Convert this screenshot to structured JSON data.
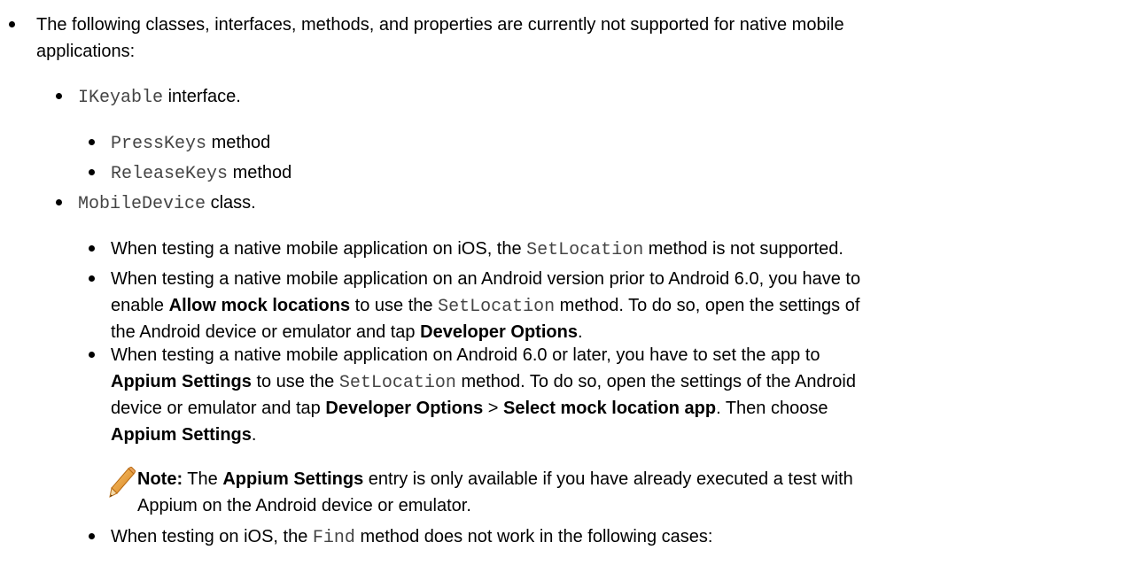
{
  "list": {
    "intro_line1": "The following classes, interfaces, methods, and properties are currently not supported for native mobile",
    "intro_line2": "applications:",
    "ikeyable": {
      "code": "IKeyable",
      "text": " interface."
    },
    "presskeys": {
      "code": "PressKeys",
      "text": " method"
    },
    "releasekeys": {
      "code": "ReleaseKeys",
      "text": " method"
    },
    "mobiledevice": {
      "code": "MobileDevice",
      "text": " class."
    },
    "item_ios": {
      "pre": "When testing a native mobile application on iOS, the ",
      "code": "SetLocation",
      "post": " method is not supported."
    },
    "item_android_old": {
      "l1": "When testing a native mobile application on an Android version prior to Android 6.0, you have to",
      "l2_pre": "enable ",
      "l2_bold": "Allow mock locations",
      "l2_mid": " to use the ",
      "l2_code": "SetLocation",
      "l2_post": " method. To do so, open the settings of",
      "l3_pre": "the Android device or emulator and tap ",
      "l3_bold": "Developer Options",
      "l3_post": "."
    },
    "item_android_new": {
      "l1": "When testing a native mobile application on Android 6.0 or later, you have to set the app to",
      "l2_bold": "Appium Settings",
      "l2_mid": " to use the ",
      "l2_code": "SetLocation",
      "l2_post": " method. To do so, open the settings of the Android",
      "l3_pre": "device or emulator and tap ",
      "l3_bold1": "Developer Options",
      "l3_mid": " > ",
      "l3_bold2": "Select mock location app",
      "l3_post": ". Then choose",
      "l4_bold": "Appium Settings",
      "l4_post": "."
    },
    "note": {
      "label": "Note:",
      "pre": " The ",
      "bold": "Appium Settings",
      "post": " entry is only available if you have already executed a test with",
      "l2": "Appium on the Android device or emulator."
    },
    "item_find": {
      "pre": "When testing on iOS, the ",
      "code": "Find",
      "post": " method does not work in the following cases:"
    }
  }
}
